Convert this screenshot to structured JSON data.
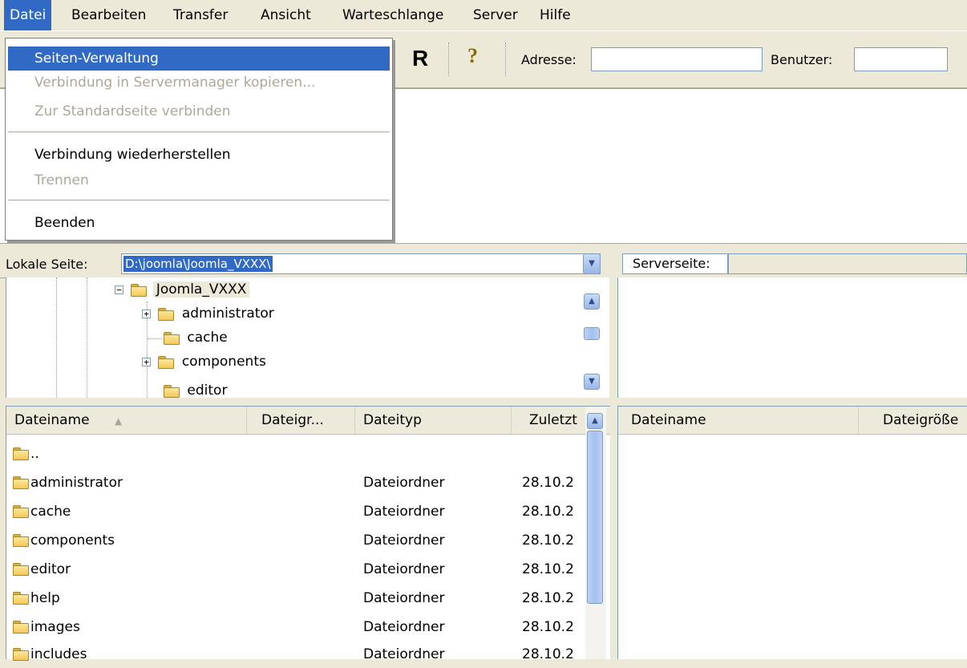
{
  "menubar": {
    "items": [
      {
        "label": "Datei"
      },
      {
        "label": "Bearbeiten"
      },
      {
        "label": "Transfer"
      },
      {
        "label": "Ansicht"
      },
      {
        "label": "Warteschlange"
      },
      {
        "label": "Server"
      },
      {
        "label": "Hilfe"
      }
    ]
  },
  "file_menu": {
    "items": [
      {
        "label": "Seiten-Verwaltung",
        "state": "highlighted"
      },
      {
        "label": "Verbindung in Servermanager kopieren...",
        "state": "disabled"
      },
      {
        "label": "Zur Standardseite verbinden",
        "state": "disabled"
      },
      {
        "label": "Verbindung wiederherstellen",
        "state": "enabled"
      },
      {
        "label": "Trennen",
        "state": "disabled"
      },
      {
        "label": "Beenden",
        "state": "enabled"
      }
    ]
  },
  "toolbar": {
    "reconnect_glyph": "R",
    "help_glyph": "?",
    "address_label": "Adresse:",
    "address_value": "",
    "user_label": "Benutzer:",
    "user_value": ""
  },
  "local": {
    "label": "Lokale Seite:",
    "path": "D:\\joomla\\Joomla_VXXX\\",
    "tree": [
      {
        "label": "Joomla_VXXX",
        "expander": "minus",
        "selected": true
      },
      {
        "label": "administrator",
        "expander": "plus"
      },
      {
        "label": "cache",
        "expander": "none"
      },
      {
        "label": "components",
        "expander": "plus"
      },
      {
        "label": "editor",
        "expander": "none"
      }
    ],
    "columns": [
      "Dateiname",
      "Dateigr...",
      "Dateityp",
      "Zuletzt"
    ],
    "sort_indicator": "▲",
    "files": [
      {
        "name": "..",
        "size": "",
        "type": "",
        "modified": ""
      },
      {
        "name": "administrator",
        "size": "",
        "type": "Dateiordner",
        "modified": "28.10.2"
      },
      {
        "name": "cache",
        "size": "",
        "type": "Dateiordner",
        "modified": "28.10.2"
      },
      {
        "name": "components",
        "size": "",
        "type": "Dateiordner",
        "modified": "28.10.2"
      },
      {
        "name": "editor",
        "size": "",
        "type": "Dateiordner",
        "modified": "28.10.2"
      },
      {
        "name": "help",
        "size": "",
        "type": "Dateiordner",
        "modified": "28.10.2"
      },
      {
        "name": "images",
        "size": "",
        "type": "Dateiordner",
        "modified": "28.10.2"
      },
      {
        "name": "includes",
        "size": "",
        "type": "Dateiordner",
        "modified": "28.10.2"
      }
    ]
  },
  "remote": {
    "label": "Serverseite:",
    "path": "",
    "columns": [
      "Dateiname",
      "Dateigröße"
    ]
  },
  "colors": {
    "highlight": "#316ac5",
    "window_bg": "#ece9d8",
    "disabled_text": "#aca899"
  },
  "icons": {
    "folder": "folder-icon",
    "expander_plus": "plus-expander-icon",
    "expander_minus": "minus-expander-icon",
    "scroll_up": "scroll-up-icon",
    "scroll_down": "scroll-down-icon",
    "dropdown": "chevron-down-icon",
    "help": "help-icon"
  }
}
